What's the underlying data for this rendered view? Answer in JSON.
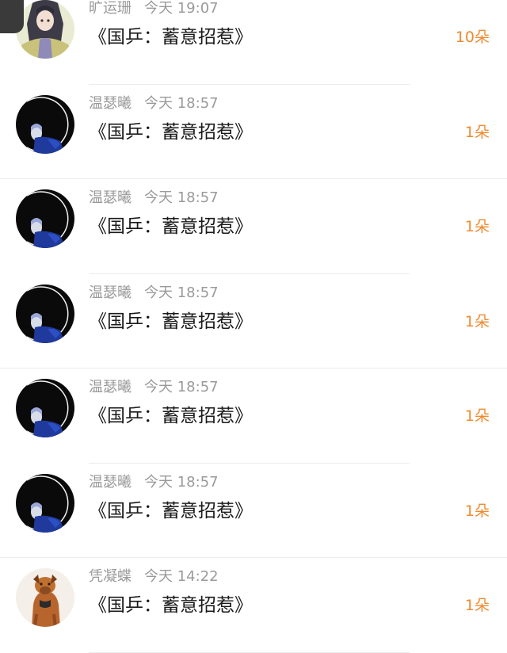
{
  "rows": [
    {
      "name": "旷运珊",
      "time": "今天 19:07",
      "message": "《国乒：蓄意招惹》",
      "count": "10朵",
      "avatar": "anime-girl-avatar"
    },
    {
      "name": "温瑟曦",
      "time": "今天 18:57",
      "message": "《国乒：蓄意招惹》",
      "count": "1朵",
      "avatar": "dark-portrait-avatar"
    },
    {
      "name": "温瑟曦",
      "time": "今天 18:57",
      "message": "《国乒：蓄意招惹》",
      "count": "1朵",
      "avatar": "dark-portrait-avatar"
    },
    {
      "name": "温瑟曦",
      "time": "今天 18:57",
      "message": "《国乒：蓄意招惹》",
      "count": "1朵",
      "avatar": "dark-portrait-avatar"
    },
    {
      "name": "温瑟曦",
      "time": "今天 18:57",
      "message": "《国乒：蓄意招惹》",
      "count": "1朵",
      "avatar": "dark-portrait-avatar"
    },
    {
      "name": "温瑟曦",
      "time": "今天 18:57",
      "message": "《国乒：蓄意招惹》",
      "count": "1朵",
      "avatar": "dark-portrait-avatar"
    },
    {
      "name": "凭凝蝶",
      "time": "今天 14:22",
      "message": "《国乒：蓄意招惹》",
      "count": "1朵",
      "avatar": "dog-photo-avatar"
    }
  ],
  "colors": {
    "name_text": "#9a9a9a",
    "message_text": "#1a1a1a",
    "count_text": "#f08a2e",
    "divider": "#ececec"
  }
}
